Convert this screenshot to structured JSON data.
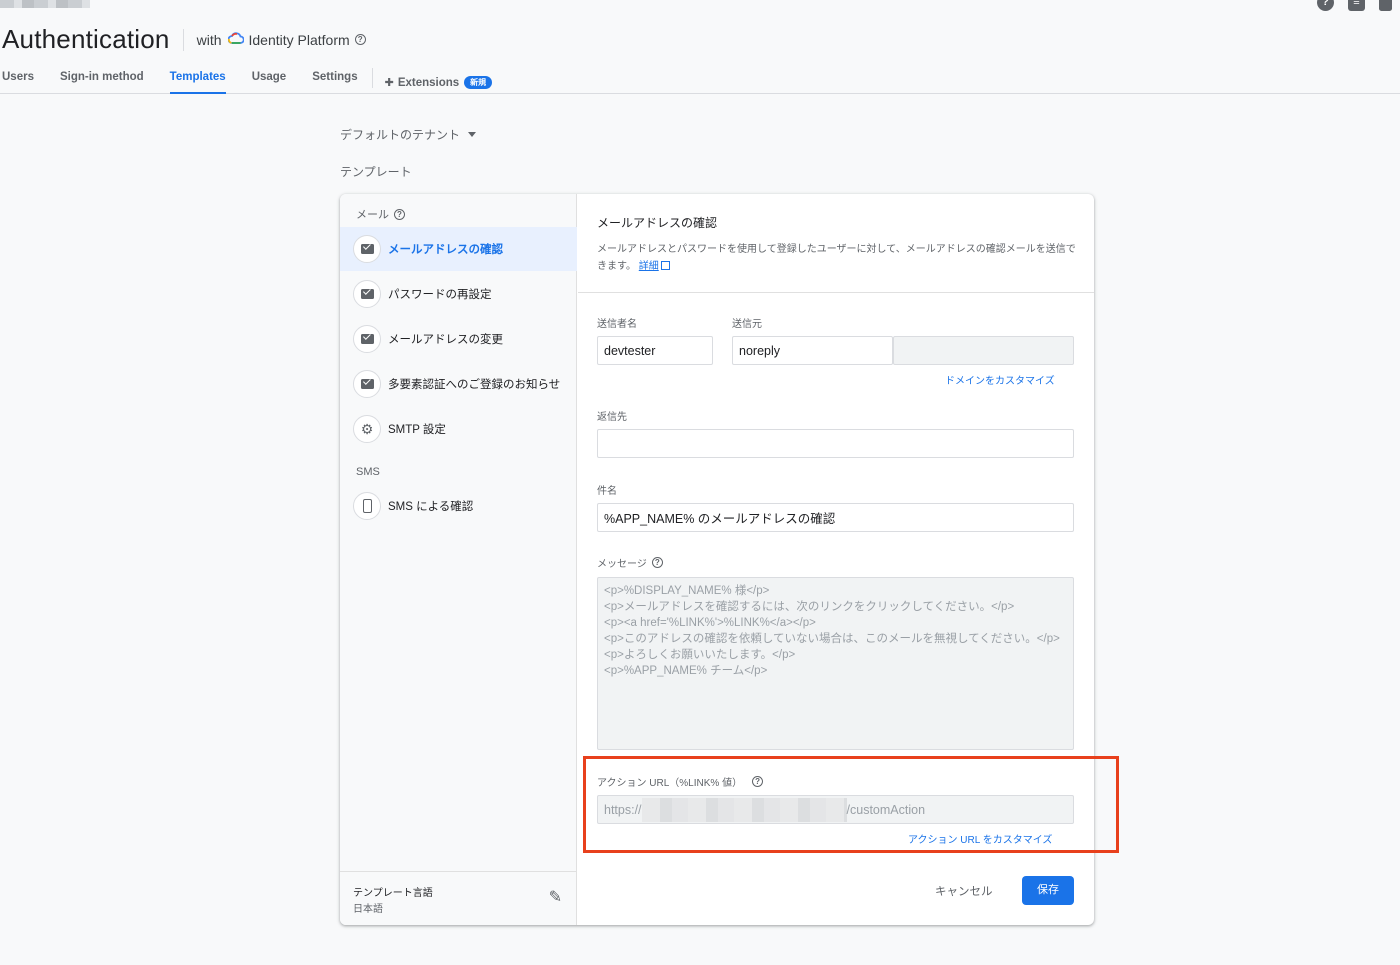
{
  "header": {
    "title": "Authentication",
    "with_label": "with",
    "identity_platform": "Identity Platform",
    "help_glyph": "?",
    "icons": [
      "help-icon",
      "doc-icon",
      "bell-icon"
    ]
  },
  "tabs": [
    {
      "label": "Users",
      "active": false
    },
    {
      "label": "Sign-in method",
      "active": false
    },
    {
      "label": "Templates",
      "active": true
    },
    {
      "label": "Usage",
      "active": false
    },
    {
      "label": "Settings",
      "active": false
    }
  ],
  "extensions_tab": {
    "label": "Extensions",
    "badge": "新規"
  },
  "tenant": {
    "label": "デフォルトのテナント"
  },
  "templates_heading": "テンプレート",
  "left_panel": {
    "mail_section": "メール",
    "sms_section": "SMS",
    "items": [
      {
        "label": "メールアドレスの確認",
        "icon": "mail-icon",
        "active": true
      },
      {
        "label": "パスワードの再設定",
        "icon": "mail-icon",
        "active": false
      },
      {
        "label": "メールアドレスの変更",
        "icon": "mail-icon",
        "active": false
      },
      {
        "label": "多要素認証へのご登録のお知らせ",
        "icon": "mail-icon",
        "active": false
      },
      {
        "label": "SMTP 設定",
        "icon": "gear-icon",
        "active": false
      }
    ],
    "sms_items": [
      {
        "label": "SMS による確認",
        "icon": "phone-icon",
        "active": false
      }
    ],
    "language": {
      "label": "テンプレート言語",
      "value": "日本語"
    }
  },
  "editor": {
    "title": "メールアドレスの確認",
    "description": "メールアドレスとパスワードを使用して登録したユーザーに対して、メールアドレスの確認メールを送信できます。",
    "details_link": "詳細",
    "sender_name_label": "送信者名",
    "sender_name_value": "devtester",
    "from_label": "送信元",
    "from_value": "noreply",
    "customize_domain_link": "ドメインをカスタマイズ",
    "reply_to_label": "返信先",
    "reply_to_value": "",
    "subject_label": "件名",
    "subject_value": "%APP_NAME% のメールアドレスの確認",
    "message_label": "メッセージ",
    "message_value": "<p>%DISPLAY_NAME% 様</p>\n<p>メールアドレスを確認するには、次のリンクをクリックしてください。</p>\n<p><a href='%LINK%'>%LINK%</a></p>\n<p>このアドレスの確認を依頼していない場合は、このメールを無視してください。</p>\n<p>よろしくお願いいたします。</p>\n<p>%APP_NAME% チーム</p>",
    "action_url_label": "アクション URL（%LINK% 値）",
    "action_url_prefix": "https://",
    "action_url_suffix": "/customAction",
    "customize_action_url_link": "アクション URL をカスタマイズ",
    "cancel_label": "キャンセル",
    "save_label": "保存"
  },
  "colors": {
    "accent": "#1a73e8",
    "highlight": "#e8401c"
  }
}
